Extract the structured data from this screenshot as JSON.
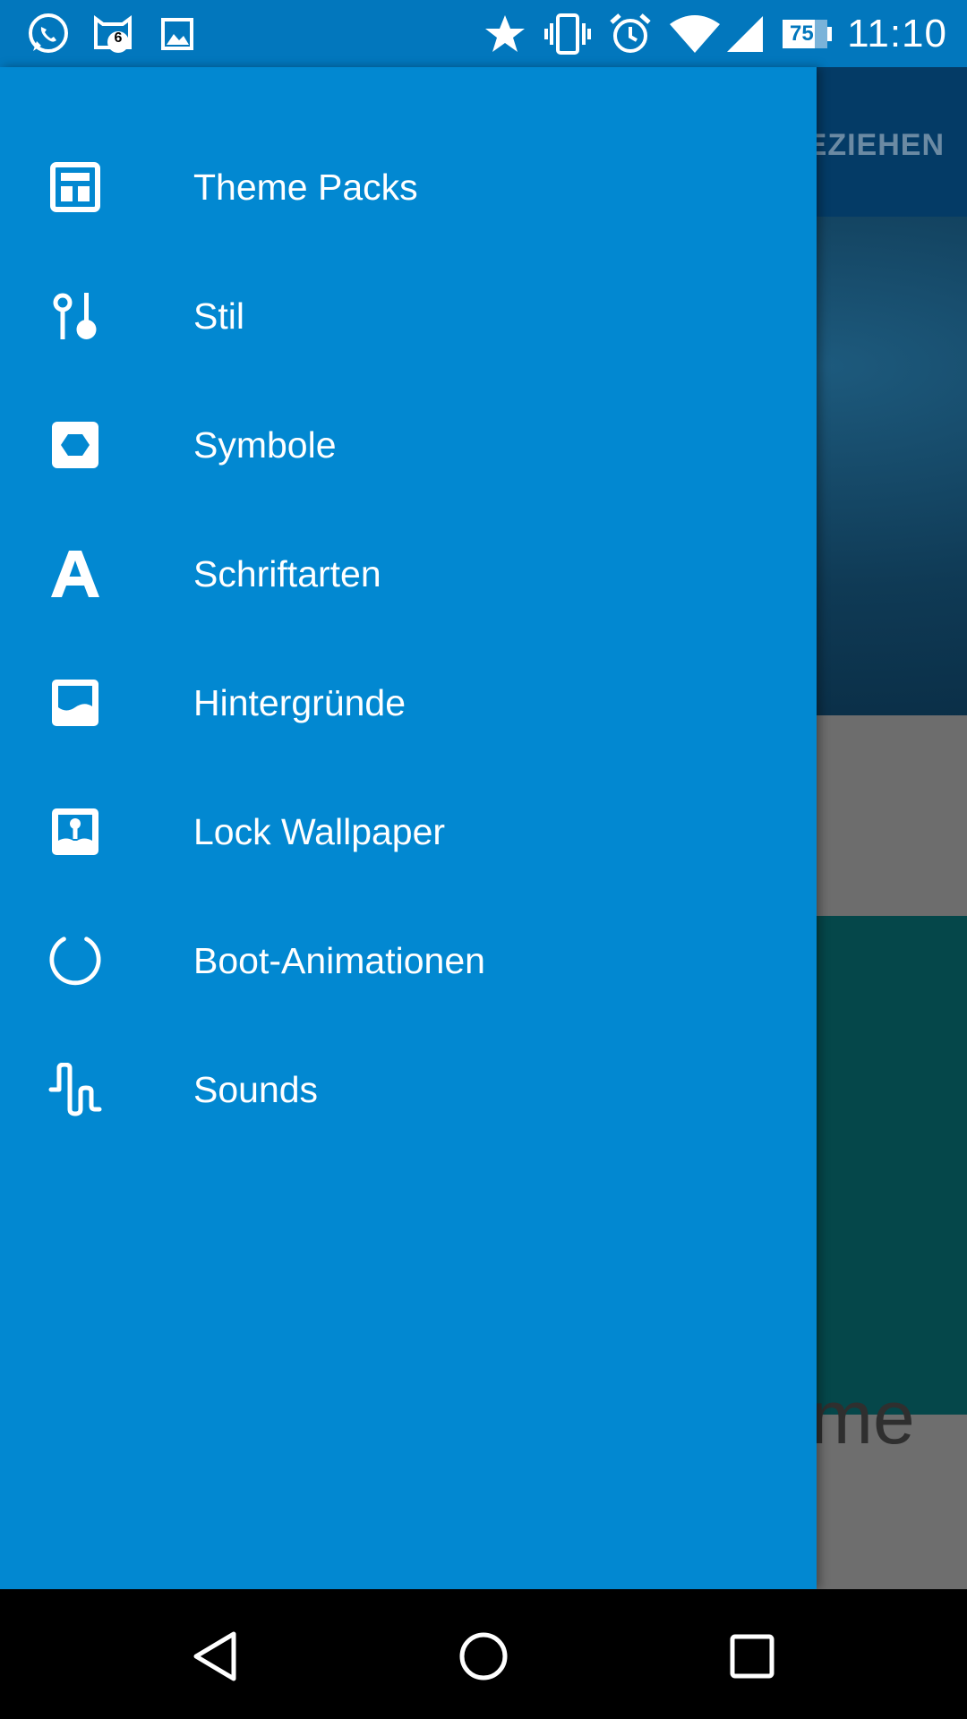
{
  "status_bar": {
    "time": "11:10",
    "battery_level": "75",
    "notification_badge": "6",
    "icons": [
      "whatsapp-icon",
      "cat-notification-icon",
      "image-icon",
      "star-icon",
      "vibrate-icon",
      "alarm-icon",
      "wifi-icon",
      "cell-signal-icon",
      "battery-icon"
    ]
  },
  "background": {
    "tab_label": "EZIEHEN",
    "bottom_text": "me"
  },
  "drawer": {
    "items": [
      {
        "label": "Theme Packs",
        "icon": "theme-packs-icon"
      },
      {
        "label": "Stil",
        "icon": "style-icon"
      },
      {
        "label": "Symbole",
        "icon": "symbols-icon"
      },
      {
        "label": "Schriftarten",
        "icon": "font-icon"
      },
      {
        "label": "Hintergründe",
        "icon": "wallpaper-icon"
      },
      {
        "label": "Lock Wallpaper",
        "icon": "lock-wallpaper-icon"
      },
      {
        "label": "Boot-Animationen",
        "icon": "boot-animation-icon"
      },
      {
        "label": "Sounds",
        "icon": "sounds-icon"
      }
    ]
  },
  "colors": {
    "drawer": "#0288d1",
    "status_bar": "#0277bd",
    "toolbar": "#043b66"
  },
  "navigation_bar": {
    "buttons": [
      "back-icon",
      "home-icon",
      "recents-icon"
    ]
  }
}
